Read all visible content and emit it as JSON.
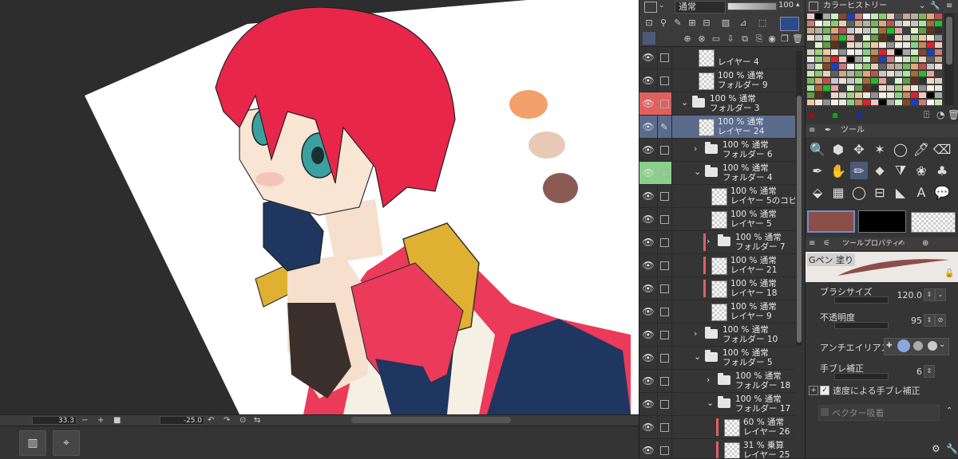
{
  "canvas": {
    "palette_colors": [
      "#f4a06a",
      "#e8c9b5",
      "#8c5a54"
    ],
    "hair_color": "#e8264a",
    "suit_navy": "#1e3660",
    "accent_yellow": "#e0b030"
  },
  "status_bar": {
    "zoom": "33.3",
    "rotation": "-25.0"
  },
  "nav": {
    "btn1_icon": "panel-toggle-icon",
    "btn2_icon": "navigator-icon"
  },
  "layer_toolbar": {
    "blend_mode": "通常",
    "opacity": "100"
  },
  "layers": [
    {
      "pct": "",
      "mode": "",
      "name": "レイヤー 4",
      "kind": "layer",
      "indent": 2,
      "vis": true
    },
    {
      "pct": "100 %",
      "mode": "通常",
      "name": "フォルダー 9",
      "kind": "layer",
      "indent": 2,
      "vis": true
    },
    {
      "pct": "100 %",
      "mode": "通常",
      "name": "フォルダー 3",
      "kind": "folder-open",
      "indent": 1,
      "vis": true,
      "lock_red": true
    },
    {
      "pct": "100 %",
      "mode": "通常",
      "name": "レイヤー 24",
      "kind": "layer",
      "indent": 2,
      "vis": true,
      "selected": true
    },
    {
      "pct": "100 %",
      "mode": "通常",
      "name": "フォルダー 6",
      "kind": "folder-closed",
      "indent": 2,
      "vis": true
    },
    {
      "pct": "100 %",
      "mode": "通常",
      "name": "フォルダー 4",
      "kind": "folder-open",
      "indent": 2,
      "vis": true,
      "lock_green": true
    },
    {
      "pct": "100 %",
      "mode": "通常",
      "name": "レイヤー 5のコピー",
      "kind": "layer",
      "indent": 3,
      "vis": true
    },
    {
      "pct": "100 %",
      "mode": "通常",
      "name": "レイヤー 5",
      "kind": "layer",
      "indent": 3,
      "vis": true
    },
    {
      "pct": "100 %",
      "mode": "通常",
      "name": "フォルダー 7",
      "kind": "folder-closed",
      "indent": 3,
      "vis": true,
      "red": true
    },
    {
      "pct": "100 %",
      "mode": "通常",
      "name": "レイヤー 21",
      "kind": "layer",
      "indent": 3,
      "vis": true,
      "red": true
    },
    {
      "pct": "100 %",
      "mode": "通常",
      "name": "レイヤー 18",
      "kind": "layer",
      "indent": 3,
      "vis": true,
      "red": true
    },
    {
      "pct": "100 %",
      "mode": "通常",
      "name": "レイヤー 9",
      "kind": "layer",
      "indent": 3,
      "vis": true
    },
    {
      "pct": "100 %",
      "mode": "通常",
      "name": "フォルダー 10",
      "kind": "folder-closed",
      "indent": 2,
      "vis": true
    },
    {
      "pct": "100 %",
      "mode": "通常",
      "name": "フォルダー 5",
      "kind": "folder-open",
      "indent": 2,
      "vis": true
    },
    {
      "pct": "100 %",
      "mode": "通常",
      "name": "フォルダー 18",
      "kind": "folder-closed",
      "indent": 3,
      "vis": true
    },
    {
      "pct": "100 %",
      "mode": "通常",
      "name": "フォルダー 17",
      "kind": "folder-open",
      "indent": 3,
      "vis": true
    },
    {
      "pct": "60 %",
      "mode": "通常",
      "name": "レイヤー 26",
      "kind": "layer",
      "indent": 4,
      "vis": true,
      "red": true
    },
    {
      "pct": "31 %",
      "mode": "乗算",
      "name": "レイヤー 25",
      "kind": "layer",
      "indent": 4,
      "vis": true,
      "red": true
    }
  ],
  "color_history": {
    "title": "カラーヒストリー"
  },
  "tool_panel": {
    "title": "ツール"
  },
  "colors": {
    "main": "#8c4e48",
    "sub": "#000000"
  },
  "tool_property": {
    "title": "ツールプロパティ",
    "preset_name": "Gペン 塗り",
    "brush_size_label": "ブラシサイズ",
    "brush_size": "120.0",
    "opacity_label": "不透明度",
    "opacity": "95",
    "antialias_label": "アンチエイリアス",
    "stabilization_label": "手ブレ補正",
    "stabilization": "6",
    "speed_stab_label": "速度による手ブレ補正",
    "vector_snap_label": "ベクター吸着"
  }
}
